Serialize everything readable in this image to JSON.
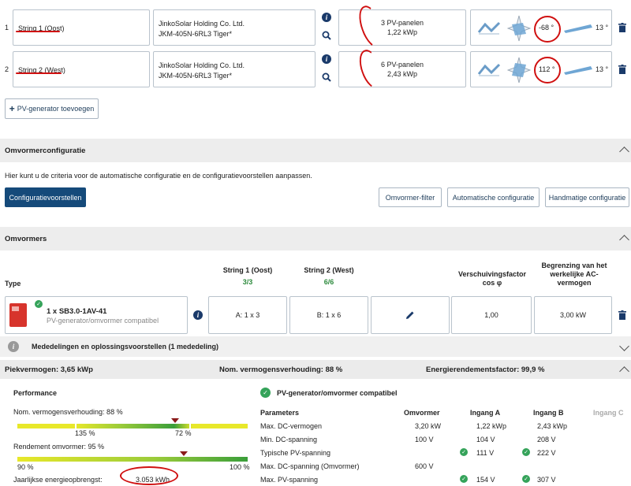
{
  "strings": [
    {
      "num": "1",
      "name": "String 1 (Oost)",
      "manufacturer": "JinkoSolar Holding Co. Ltd.",
      "model": "JKM-405N-6RL3 Tiger*",
      "panels": "3 PV-panelen",
      "power": "1,22 kWp",
      "azimuth": "-68 °",
      "tilt": "13 °"
    },
    {
      "num": "2",
      "name": "String 2 (West)",
      "manufacturer": "JinkoSolar Holding Co. Ltd.",
      "model": "JKM-405N-6RL3 Tiger*",
      "panels": "6 PV-panelen",
      "power": "2,43 kWp",
      "azimuth": "112 °",
      "tilt": "13 °"
    }
  ],
  "add_generator": "PV-generator toevoegen",
  "config": {
    "title": "Omvormerconfiguratie",
    "desc": "Hier kunt u de criteria voor de automatische configuratie en de configuratievoorstellen aanpassen.",
    "btn_proposals": "Configuratievoorstellen",
    "btn_filter": "Omvormer-filter",
    "btn_auto": "Automatische configuratie",
    "btn_manual": "Handmatige configuratie"
  },
  "inverters": {
    "title": "Omvormers",
    "col_type": "Type",
    "col_s1": "String 1 (Oost)",
    "col_s1_count": "3/3",
    "col_s2": "String 2 (West)",
    "col_s2_count": "6/6",
    "col_phase": "Verschuivingsfactor cos φ",
    "col_limit": "Begrenzing van het werkelijke AC-vermogen",
    "name": "1 x SB3.0-1AV-41",
    "compat": "PV-generator/omvormer compatibel",
    "s1_val": "A: 1 x 3",
    "s2_val": "B: 1 x 6",
    "phase_val": "1,00",
    "limit_val": "3,00 kW"
  },
  "messages": "Mededelingen en oplossingsvoorstellen (1 mededeling)",
  "summary": {
    "peak": "Piekvermogen: 3,65 kWp",
    "ratio": "Nom. vermogensverhouding: 88 %",
    "yield_factor": "Energierendementsfactor: 99,9 %"
  },
  "performance": {
    "title": "Performance",
    "ratio_label": "Nom. vermogensverhouding: 88 %",
    "ratio_left": "135 %",
    "ratio_right": "72 %",
    "ratio_level": 0.88,
    "eff_label": "Rendement omvormer: 95 %",
    "eff_left": "90 %",
    "eff_right": "100 %",
    "eff_level": 0.95,
    "yield_label": "Jaarlijkse energieopbrengst:",
    "yield_value": "3.053 kWh"
  },
  "compat_panel": {
    "title": "PV-generator/omvormer compatibel",
    "headers": [
      "Parameters",
      "Omvormer",
      "Ingang A",
      "Ingang B",
      "Ingang C"
    ],
    "rows": [
      {
        "param": "Max. DC-vermogen",
        "inv": "3,20 kW",
        "a": "1,22 kWp",
        "b": "2,43 kWp",
        "a_ok": false,
        "b_ok": false
      },
      {
        "param": "Min. DC-spanning",
        "inv": "100 V",
        "a": "104 V",
        "b": "208 V",
        "a_ok": false,
        "b_ok": false
      },
      {
        "param": "Typische PV-spanning",
        "inv": "",
        "a": "111 V",
        "b": "222 V",
        "a_ok": true,
        "b_ok": true
      },
      {
        "param": "Max. DC-spanning (Omvormer)",
        "inv": "600 V",
        "a": "",
        "b": "",
        "a_ok": false,
        "b_ok": false
      },
      {
        "param": "Max. PV-spanning",
        "inv": "",
        "a": "154 V",
        "b": "307 V",
        "a_ok": true,
        "b_ok": true
      }
    ]
  },
  "colors": {
    "primary": "#154a7a",
    "annotation": "#d01010",
    "ok": "#35a35a"
  }
}
